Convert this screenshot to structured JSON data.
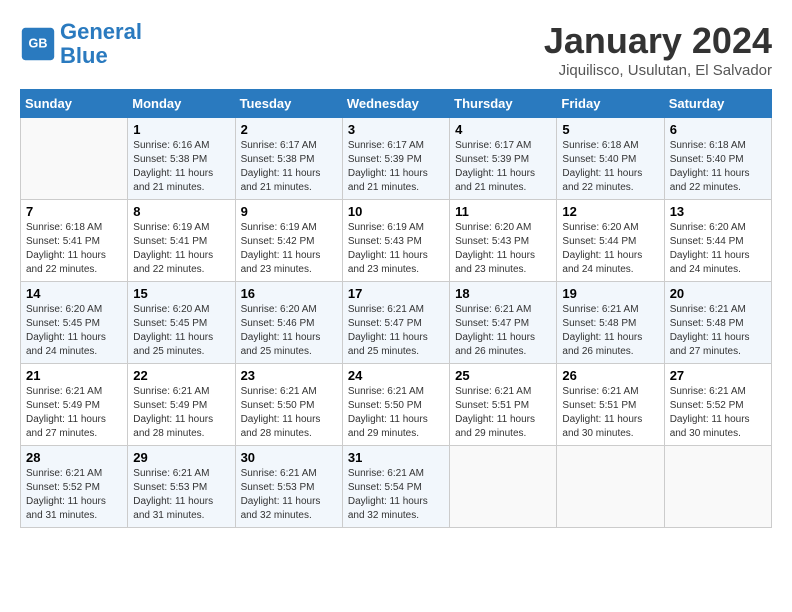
{
  "header": {
    "logo_line1": "General",
    "logo_line2": "Blue",
    "month": "January 2024",
    "location": "Jiquilisco, Usulutan, El Salvador"
  },
  "days_of_week": [
    "Sunday",
    "Monday",
    "Tuesday",
    "Wednesday",
    "Thursday",
    "Friday",
    "Saturday"
  ],
  "weeks": [
    [
      {
        "day": "",
        "info": ""
      },
      {
        "day": "1",
        "info": "Sunrise: 6:16 AM\nSunset: 5:38 PM\nDaylight: 11 hours\nand 21 minutes."
      },
      {
        "day": "2",
        "info": "Sunrise: 6:17 AM\nSunset: 5:38 PM\nDaylight: 11 hours\nand 21 minutes."
      },
      {
        "day": "3",
        "info": "Sunrise: 6:17 AM\nSunset: 5:39 PM\nDaylight: 11 hours\nand 21 minutes."
      },
      {
        "day": "4",
        "info": "Sunrise: 6:17 AM\nSunset: 5:39 PM\nDaylight: 11 hours\nand 21 minutes."
      },
      {
        "day": "5",
        "info": "Sunrise: 6:18 AM\nSunset: 5:40 PM\nDaylight: 11 hours\nand 22 minutes."
      },
      {
        "day": "6",
        "info": "Sunrise: 6:18 AM\nSunset: 5:40 PM\nDaylight: 11 hours\nand 22 minutes."
      }
    ],
    [
      {
        "day": "7",
        "info": "Sunrise: 6:18 AM\nSunset: 5:41 PM\nDaylight: 11 hours\nand 22 minutes."
      },
      {
        "day": "8",
        "info": "Sunrise: 6:19 AM\nSunset: 5:41 PM\nDaylight: 11 hours\nand 22 minutes."
      },
      {
        "day": "9",
        "info": "Sunrise: 6:19 AM\nSunset: 5:42 PM\nDaylight: 11 hours\nand 23 minutes."
      },
      {
        "day": "10",
        "info": "Sunrise: 6:19 AM\nSunset: 5:43 PM\nDaylight: 11 hours\nand 23 minutes."
      },
      {
        "day": "11",
        "info": "Sunrise: 6:20 AM\nSunset: 5:43 PM\nDaylight: 11 hours\nand 23 minutes."
      },
      {
        "day": "12",
        "info": "Sunrise: 6:20 AM\nSunset: 5:44 PM\nDaylight: 11 hours\nand 24 minutes."
      },
      {
        "day": "13",
        "info": "Sunrise: 6:20 AM\nSunset: 5:44 PM\nDaylight: 11 hours\nand 24 minutes."
      }
    ],
    [
      {
        "day": "14",
        "info": "Sunrise: 6:20 AM\nSunset: 5:45 PM\nDaylight: 11 hours\nand 24 minutes."
      },
      {
        "day": "15",
        "info": "Sunrise: 6:20 AM\nSunset: 5:45 PM\nDaylight: 11 hours\nand 25 minutes."
      },
      {
        "day": "16",
        "info": "Sunrise: 6:20 AM\nSunset: 5:46 PM\nDaylight: 11 hours\nand 25 minutes."
      },
      {
        "day": "17",
        "info": "Sunrise: 6:21 AM\nSunset: 5:47 PM\nDaylight: 11 hours\nand 25 minutes."
      },
      {
        "day": "18",
        "info": "Sunrise: 6:21 AM\nSunset: 5:47 PM\nDaylight: 11 hours\nand 26 minutes."
      },
      {
        "day": "19",
        "info": "Sunrise: 6:21 AM\nSunset: 5:48 PM\nDaylight: 11 hours\nand 26 minutes."
      },
      {
        "day": "20",
        "info": "Sunrise: 6:21 AM\nSunset: 5:48 PM\nDaylight: 11 hours\nand 27 minutes."
      }
    ],
    [
      {
        "day": "21",
        "info": "Sunrise: 6:21 AM\nSunset: 5:49 PM\nDaylight: 11 hours\nand 27 minutes."
      },
      {
        "day": "22",
        "info": "Sunrise: 6:21 AM\nSunset: 5:49 PM\nDaylight: 11 hours\nand 28 minutes."
      },
      {
        "day": "23",
        "info": "Sunrise: 6:21 AM\nSunset: 5:50 PM\nDaylight: 11 hours\nand 28 minutes."
      },
      {
        "day": "24",
        "info": "Sunrise: 6:21 AM\nSunset: 5:50 PM\nDaylight: 11 hours\nand 29 minutes."
      },
      {
        "day": "25",
        "info": "Sunrise: 6:21 AM\nSunset: 5:51 PM\nDaylight: 11 hours\nand 29 minutes."
      },
      {
        "day": "26",
        "info": "Sunrise: 6:21 AM\nSunset: 5:51 PM\nDaylight: 11 hours\nand 30 minutes."
      },
      {
        "day": "27",
        "info": "Sunrise: 6:21 AM\nSunset: 5:52 PM\nDaylight: 11 hours\nand 30 minutes."
      }
    ],
    [
      {
        "day": "28",
        "info": "Sunrise: 6:21 AM\nSunset: 5:52 PM\nDaylight: 11 hours\nand 31 minutes."
      },
      {
        "day": "29",
        "info": "Sunrise: 6:21 AM\nSunset: 5:53 PM\nDaylight: 11 hours\nand 31 minutes."
      },
      {
        "day": "30",
        "info": "Sunrise: 6:21 AM\nSunset: 5:53 PM\nDaylight: 11 hours\nand 32 minutes."
      },
      {
        "day": "31",
        "info": "Sunrise: 6:21 AM\nSunset: 5:54 PM\nDaylight: 11 hours\nand 32 minutes."
      },
      {
        "day": "",
        "info": ""
      },
      {
        "day": "",
        "info": ""
      },
      {
        "day": "",
        "info": ""
      }
    ]
  ]
}
